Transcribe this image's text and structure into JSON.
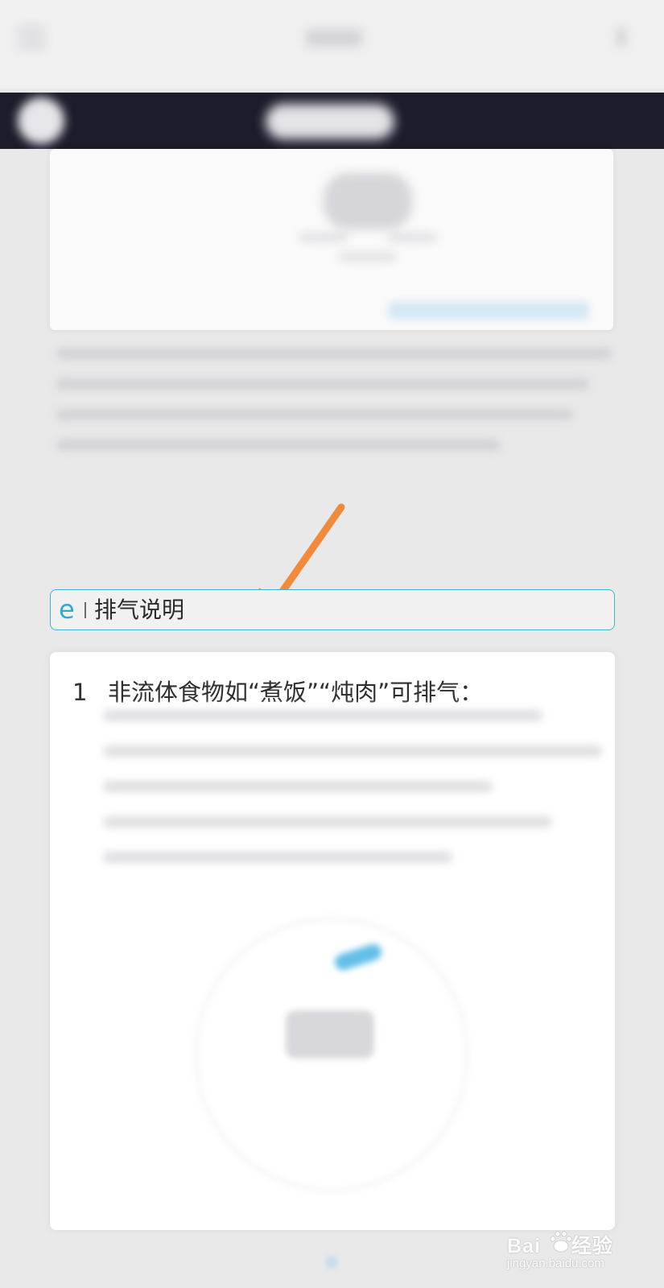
{
  "section": {
    "icon": "e-icon",
    "title": "排气说明"
  },
  "step": {
    "number": "1",
    "text": "非流体食物如“煮饭”“炖肉”可排气："
  },
  "watermark": {
    "brand_left": "Bai",
    "brand_right": "经验",
    "url": "jingyan.baidu.com",
    "paw_icon": "baidu-paw-icon"
  },
  "colors": {
    "accent": "#48aed1",
    "arrow": "#f28a3c",
    "header_dark": "#1d1c2c"
  }
}
